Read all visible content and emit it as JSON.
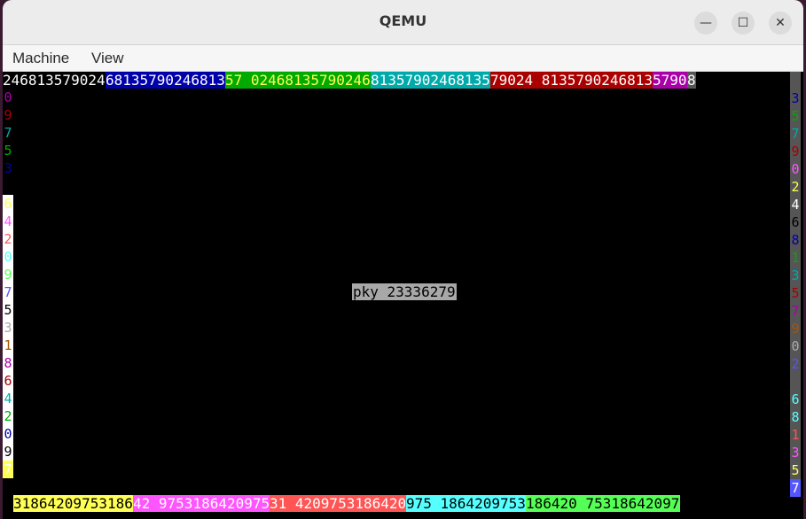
{
  "window": {
    "title": "QEMU",
    "minimize": "—",
    "maximize": "☐",
    "close": "✕"
  },
  "menu": {
    "machine": "Machine",
    "view": "View"
  },
  "screen": {
    "message": "pky 23336279",
    "top_segments": [
      {
        "text": "246813579024",
        "bg": "#000000",
        "fg": "#ffffff"
      },
      {
        "text": "68135790246813",
        "bg": "#0000aa",
        "fg": "#ffffff"
      },
      {
        "text": "57 02468135790246",
        "bg": "#00aa00",
        "fg": "#ffff55"
      },
      {
        "text": "81357902468135",
        "bg": "#00aaaa",
        "fg": "#ffffff"
      },
      {
        "text": "79024 8135790246813",
        "bg": "#aa0000",
        "fg": "#ffffff"
      },
      {
        "text": "5790",
        "bg": "#aa00aa",
        "fg": "#ffffff"
      },
      {
        "text": "8",
        "bg": "#555555",
        "fg": "#ffffff"
      }
    ],
    "bottom_segments": [
      {
        "text": "31864209753186",
        "bg": "#ffff55",
        "fg": "#000000"
      },
      {
        "text": "42 9753186420975",
        "bg": "#ff55ff",
        "fg": "#ffffff"
      },
      {
        "text": "31 4209753186420",
        "bg": "#ff5555",
        "fg": "#ffffff"
      },
      {
        "text": "975 1864209753",
        "bg": "#55ffff",
        "fg": "#000000"
      },
      {
        "text": "186420 75318642097",
        "bg": "#55ff55",
        "fg": "#000000"
      }
    ],
    "left_column": [
      {
        "ch": "0",
        "fg": "#aa00aa",
        "bg": "#000000"
      },
      {
        "ch": "9",
        "fg": "#aa0000",
        "bg": "#000000"
      },
      {
        "ch": "7",
        "fg": "#00aaaa",
        "bg": "#000000"
      },
      {
        "ch": "5",
        "fg": "#00aa00",
        "bg": "#000000"
      },
      {
        "ch": "3",
        "fg": "#0000aa",
        "bg": "#000000"
      },
      {
        "ch": "",
        "fg": "#000000",
        "bg": "#000000"
      },
      {
        "ch": "6",
        "fg": "#ffff55",
        "bg": "#ffffff"
      },
      {
        "ch": "4",
        "fg": "#ff55ff",
        "bg": "#ffffff"
      },
      {
        "ch": "2",
        "fg": "#ff5555",
        "bg": "#ffffff"
      },
      {
        "ch": "0",
        "fg": "#55ffff",
        "bg": "#ffffff"
      },
      {
        "ch": "9",
        "fg": "#55ff55",
        "bg": "#ffffff"
      },
      {
        "ch": "7",
        "fg": "#5555ff",
        "bg": "#ffffff"
      },
      {
        "ch": "5",
        "fg": "#000000",
        "bg": "#ffffff"
      },
      {
        "ch": "3",
        "fg": "#aaaaaa",
        "bg": "#ffffff"
      },
      {
        "ch": "1",
        "fg": "#aa5500",
        "bg": "#ffffff"
      },
      {
        "ch": "8",
        "fg": "#aa00aa",
        "bg": "#ffffff"
      },
      {
        "ch": "6",
        "fg": "#aa0000",
        "bg": "#ffffff"
      },
      {
        "ch": "4",
        "fg": "#00aaaa",
        "bg": "#ffffff"
      },
      {
        "ch": "2",
        "fg": "#00aa00",
        "bg": "#ffffff"
      },
      {
        "ch": "0",
        "fg": "#0000aa",
        "bg": "#ffffff"
      },
      {
        "ch": "9",
        "fg": "#000000",
        "bg": "#ffffff"
      },
      {
        "ch": "7",
        "fg": "#ffffff",
        "bg": "#ffff55"
      }
    ],
    "right_column": [
      {
        "ch": "",
        "fg": "#ffffff",
        "bg": "#555555"
      },
      {
        "ch": "3",
        "fg": "#0000aa",
        "bg": "#555555"
      },
      {
        "ch": "5",
        "fg": "#00aa00",
        "bg": "#555555"
      },
      {
        "ch": "7",
        "fg": "#00aaaa",
        "bg": "#555555"
      },
      {
        "ch": "9",
        "fg": "#aa0000",
        "bg": "#555555"
      },
      {
        "ch": "0",
        "fg": "#ff55ff",
        "bg": "#555555"
      },
      {
        "ch": "2",
        "fg": "#ffff55",
        "bg": "#555555"
      },
      {
        "ch": "4",
        "fg": "#ffffff",
        "bg": "#555555"
      },
      {
        "ch": "6",
        "fg": "#000000",
        "bg": "#555555"
      },
      {
        "ch": "8",
        "fg": "#0000aa",
        "bg": "#555555"
      },
      {
        "ch": "1",
        "fg": "#00aa00",
        "bg": "#555555"
      },
      {
        "ch": "3",
        "fg": "#00aaaa",
        "bg": "#555555"
      },
      {
        "ch": "5",
        "fg": "#aa0000",
        "bg": "#555555"
      },
      {
        "ch": "7",
        "fg": "#aa00aa",
        "bg": "#555555"
      },
      {
        "ch": "9",
        "fg": "#aa5500",
        "bg": "#555555"
      },
      {
        "ch": "0",
        "fg": "#aaaaaa",
        "bg": "#555555"
      },
      {
        "ch": "2",
        "fg": "#5555ff",
        "bg": "#555555"
      },
      {
        "ch": "",
        "fg": "#555555",
        "bg": "#555555"
      },
      {
        "ch": "6",
        "fg": "#55ffff",
        "bg": "#555555"
      },
      {
        "ch": "8",
        "fg": "#55ffff",
        "bg": "#555555"
      },
      {
        "ch": "1",
        "fg": "#ff5555",
        "bg": "#555555"
      },
      {
        "ch": "3",
        "fg": "#ff55ff",
        "bg": "#555555"
      },
      {
        "ch": "5",
        "fg": "#ffff55",
        "bg": "#555555"
      },
      {
        "ch": "7",
        "fg": "#ffffff",
        "bg": "#5555ff"
      }
    ]
  }
}
